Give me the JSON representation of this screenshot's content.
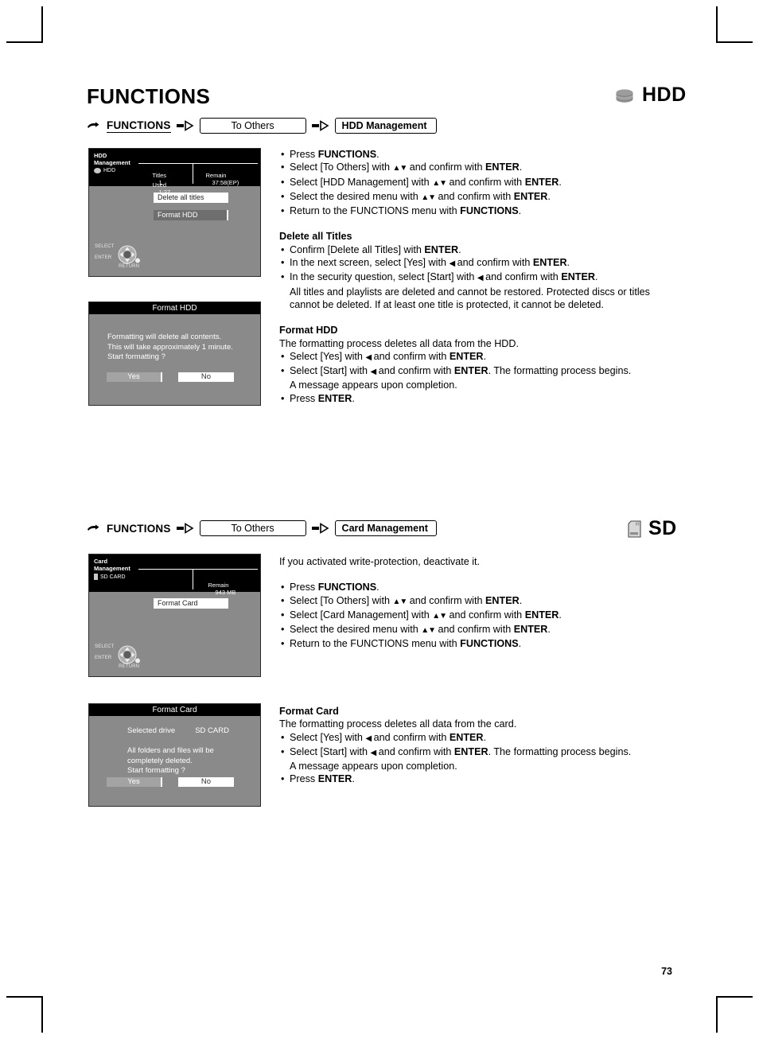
{
  "page": {
    "number": "73",
    "title": "FUNCTIONS"
  },
  "sections": [
    {
      "id": "hdd",
      "logo": {
        "label": "HDD",
        "icon": "hdd-disc-icon"
      },
      "breadcrumb": {
        "hand_icon": "pointing-hand-icon",
        "root": "FUNCTIONS",
        "arrow_icon": "arrow-right-icon",
        "step1": "To Others",
        "step2": "HDD Management"
      },
      "screen": {
        "title_line1": "HDD",
        "title_line2": "Management",
        "media_label": "HDD",
        "media_icon": "hdd-disc-icon",
        "stats": [
          {
            "label": "Titles",
            "value": "1"
          },
          {
            "label": "Used",
            "value": "1:27"
          },
          {
            "label": "Remain",
            "value": "37:58(EP)"
          }
        ],
        "menu": [
          {
            "label": "Delete all titles",
            "selected": true
          },
          {
            "label": "Format HDD",
            "selected": false
          }
        ],
        "dpad": {
          "select": "SELECT",
          "enter": "ENTER",
          "return": "RETURN",
          "icon": "dpad-icon"
        }
      },
      "dialog": {
        "title": "Format HDD",
        "lines": [
          "Formatting will delete all contents.",
          "This will take approximately 1 minute.",
          "Start formatting ?"
        ],
        "yes": "Yes",
        "no": "No"
      },
      "steps": [
        [
          {
            "t": "Press "
          },
          {
            "t": "FUNCTIONS",
            "b": true
          },
          {
            "t": "."
          }
        ],
        [
          {
            "t": "Select [To Others] with "
          },
          {
            "t": "▲▼",
            "g": true
          },
          {
            "t": " and confirm with "
          },
          {
            "t": "ENTER",
            "b": true
          },
          {
            "t": "."
          }
        ],
        [
          {
            "t": "Select [HDD Management] with "
          },
          {
            "t": "▲▼",
            "g": true
          },
          {
            "t": " and confirm with "
          },
          {
            "t": "ENTER",
            "b": true
          },
          {
            "t": "."
          }
        ],
        [
          {
            "t": "Select the desired menu with "
          },
          {
            "t": "▲▼",
            "g": true
          },
          {
            "t": " and confirm with "
          },
          {
            "t": "ENTER",
            "b": true
          },
          {
            "t": "."
          }
        ],
        [
          {
            "t": "Return to the FUNCTIONS menu with "
          },
          {
            "t": "FUNCTIONS",
            "b": true
          },
          {
            "t": "."
          }
        ]
      ],
      "blocks": [
        {
          "heading": "Delete all Titles",
          "intro": null,
          "steps": [
            [
              {
                "t": "Confirm [Delete all Titles] with "
              },
              {
                "t": "ENTER",
                "b": true
              },
              {
                "t": "."
              }
            ],
            [
              {
                "t": "In the next screen, select [Yes] with "
              },
              {
                "t": "◀",
                "g": true
              },
              {
                "t": " and confirm with "
              },
              {
                "t": "ENTER",
                "b": true
              },
              {
                "t": "."
              }
            ],
            [
              {
                "t": "In the security question, select [Start] with "
              },
              {
                "t": "◀",
                "g": true
              },
              {
                "t": " and confirm with "
              },
              {
                "t": "ENTER",
                "b": true
              },
              {
                "t": "."
              }
            ]
          ],
          "continuation": [
            "All titles and playlists are deleted and cannot be restored. Protected discs or titles",
            "cannot be deleted. If at least one title is protected, it cannot be deleted."
          ]
        },
        {
          "heading": "Format HDD",
          "intro": "The formatting process deletes all data from the HDD.",
          "steps": [
            [
              {
                "t": "Select [Yes] with "
              },
              {
                "t": "◀",
                "g": true
              },
              {
                "t": " and confirm with "
              },
              {
                "t": "ENTER",
                "b": true
              },
              {
                "t": "."
              }
            ],
            [
              {
                "t": "Select [Start] with "
              },
              {
                "t": "◀",
                "g": true
              },
              {
                "t": " and confirm with "
              },
              {
                "t": "ENTER",
                "b": true
              },
              {
                "t": ". The formatting process begins."
              }
            ],
            [
              {
                "t": "Press "
              },
              {
                "t": "ENTER",
                "b": true
              },
              {
                "t": "."
              }
            ]
          ],
          "mid_continuation": {
            "after": 1,
            "text": "A message appears upon completion."
          }
        }
      ]
    },
    {
      "id": "sd",
      "logo": {
        "label": "SD",
        "icon": "sd-card-icon"
      },
      "breadcrumb": {
        "hand_icon": "pointing-hand-icon",
        "root": "FUNCTIONS",
        "arrow_icon": "arrow-right-icon",
        "step1": "To Others",
        "step2": "Card Management"
      },
      "screen": {
        "title_line1": "Card",
        "title_line2": "Management",
        "media_label": "SD CARD",
        "media_icon": "sd-card-icon",
        "stats": [
          {
            "label": "Remain",
            "value": "943 MB"
          }
        ],
        "menu": [
          {
            "label": "Format Card",
            "selected": true
          }
        ],
        "dpad": {
          "select": "SELECT",
          "enter": "ENTER",
          "return": "RETURN",
          "icon": "dpad-icon"
        }
      },
      "dialog": {
        "title": "Format Card",
        "drive_label": "Selected drive",
        "drive_value": "SD CARD",
        "lines": [
          "All folders and files will be",
          "completely deleted.",
          "Start formatting ?"
        ],
        "yes": "Yes",
        "no": "No"
      },
      "note": "If you activated write-protection, deactivate it.",
      "steps": [
        [
          {
            "t": "Press "
          },
          {
            "t": "FUNCTIONS",
            "b": true
          },
          {
            "t": "."
          }
        ],
        [
          {
            "t": "Select [To Others] with "
          },
          {
            "t": "▲▼",
            "g": true
          },
          {
            "t": " and confirm with "
          },
          {
            "t": "ENTER",
            "b": true
          },
          {
            "t": "."
          }
        ],
        [
          {
            "t": "Select [Card Management] with "
          },
          {
            "t": "▲▼",
            "g": true
          },
          {
            "t": " and confirm with "
          },
          {
            "t": "ENTER",
            "b": true
          },
          {
            "t": "."
          }
        ],
        [
          {
            "t": "Select the desired menu with "
          },
          {
            "t": "▲▼",
            "g": true
          },
          {
            "t": " and confirm with "
          },
          {
            "t": "ENTER",
            "b": true
          },
          {
            "t": "."
          }
        ],
        [
          {
            "t": "Return to the FUNCTIONS menu with "
          },
          {
            "t": "FUNCTIONS",
            "b": true
          },
          {
            "t": "."
          }
        ]
      ],
      "blocks": [
        {
          "heading": "Format Card",
          "intro": "The formatting process deletes all data from the card.",
          "steps": [
            [
              {
                "t": "Select [Yes] with "
              },
              {
                "t": "◀",
                "g": true
              },
              {
                "t": " and confirm with "
              },
              {
                "t": "ENTER",
                "b": true
              },
              {
                "t": "."
              }
            ],
            [
              {
                "t": "Select [Start] with "
              },
              {
                "t": "◀",
                "g": true
              },
              {
                "t": " and confirm with "
              },
              {
                "t": "ENTER",
                "b": true
              },
              {
                "t": ". The formatting process begins."
              }
            ],
            [
              {
                "t": "Press "
              },
              {
                "t": "ENTER",
                "b": true
              },
              {
                "t": "."
              }
            ]
          ],
          "mid_continuation": {
            "after": 1,
            "text": "A message appears upon completion."
          }
        }
      ]
    }
  ],
  "colors": {
    "screen_bg": "#8a8a8a",
    "screen_header": "#000000",
    "selected": "#ffffff",
    "unselected": "#6e6e6e"
  }
}
